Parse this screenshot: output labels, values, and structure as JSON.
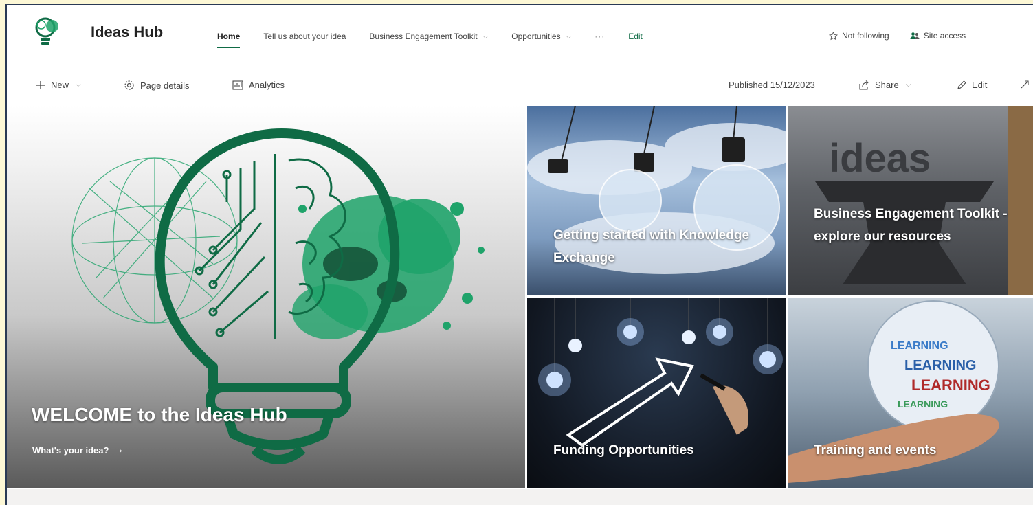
{
  "site": {
    "title": "Ideas Hub"
  },
  "nav": {
    "items": [
      {
        "label": "Home",
        "active": true
      },
      {
        "label": "Tell us about your idea"
      },
      {
        "label": "Business Engagement Toolkit"
      },
      {
        "label": "Opportunities"
      }
    ],
    "more": "···",
    "edit": "Edit"
  },
  "header_actions": {
    "follow": "Not following",
    "site_access": "Site access"
  },
  "commandbar": {
    "new": "New",
    "page_details": "Page details",
    "analytics": "Analytics",
    "published": "Published 15/12/2023",
    "share": "Share",
    "edit": "Edit"
  },
  "hero": {
    "main": {
      "title": "WELCOME to the Ideas Hub",
      "link": "What's your idea?",
      "arrow": "→"
    },
    "tiles": [
      {
        "label": "Getting started with Knowledge Exchange"
      },
      {
        "label": "Business Engagement Toolkit - explore our resources"
      },
      {
        "label": "Funding Opportunities"
      },
      {
        "label": "Training and events"
      }
    ],
    "tile2_word": "ideas",
    "globe_word": "LEARNING"
  },
  "colors": {
    "accent": "#0f6b45",
    "splash": "#1fa36a",
    "border": "#2a3a55"
  }
}
